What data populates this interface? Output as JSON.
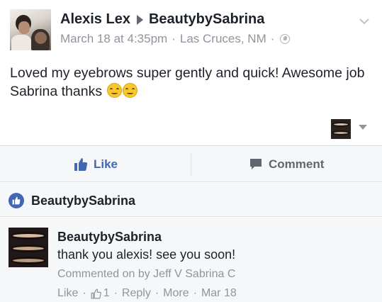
{
  "post": {
    "author": "Alexis Lex",
    "target_page": "BeautybySabrina",
    "date": "March 18 at 4:35pm",
    "location": "Las Cruces, NM",
    "separator": "·",
    "privacy_icon": "globe-icon",
    "text_main": "Loved my eyebrows super gently and quick! Awesome job Sabrina thanks ",
    "emojis": [
      "smiling-face-icon",
      "smiling-face-icon"
    ]
  },
  "actions": {
    "like_label": "Like",
    "comment_label": "Comment"
  },
  "likes": {
    "name": "BeautybySabrina"
  },
  "comment": {
    "author": "BeautybySabrina",
    "text": "thank you alexis! see you soon!",
    "commented_on_by": "Commented on by Jeff V Sabrina C",
    "like_label": "Like",
    "like_count": "1",
    "reply_label": "Reply",
    "more_label": "More",
    "date": "Mar 18",
    "separator": "·"
  },
  "colors": {
    "brand_blue": "#4267b2",
    "meta_gray": "#90949c",
    "bar_background": "#f6f7f9"
  }
}
